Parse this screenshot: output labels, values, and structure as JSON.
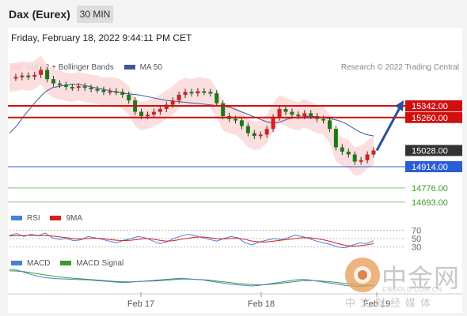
{
  "header": {
    "title": "Dax (Eurex)",
    "timeframe": "30 MIN",
    "datetime": "Friday, February 18, 2022 9:44:11 PM CET"
  },
  "legends": {
    "main": [
      {
        "label": "MA 20 + Bollinger Bands",
        "color": "#f08a8a"
      },
      {
        "label": "MA 50",
        "color": "#3a5a9c"
      }
    ],
    "rsi": [
      {
        "label": "RSI",
        "color": "#4a7fd4"
      },
      {
        "label": "9MA",
        "color": "#d42020"
      }
    ],
    "macd": [
      {
        "label": "MACD",
        "color": "#4a7fd4"
      },
      {
        "label": "MACD Signal",
        "color": "#3a9a2a"
      }
    ]
  },
  "research": "Research © 2022 Trading Central",
  "watermark": {
    "chinese": "中金网",
    "url": "CNGOLD.COM.CN",
    "subtitle": "中文财经媒体"
  },
  "colors": {
    "resistance": "#d01010",
    "support": "#2a5fd4",
    "target": "#3a9a2a",
    "last_price_box": "#333333",
    "arrow": "#2a4f9c"
  },
  "chart_data": {
    "type": "line",
    "x_ticks": [
      "Feb 17",
      "Feb 18",
      "Feb 19"
    ],
    "price_levels": [
      {
        "value": "15342.00",
        "kind": "resistance"
      },
      {
        "value": "15260.00",
        "kind": "resistance"
      },
      {
        "value": "15028.00",
        "kind": "last"
      },
      {
        "value": "14914.00",
        "kind": "support"
      },
      {
        "value": "14776.00",
        "kind": "target"
      },
      {
        "value": "14693.00",
        "kind": "target"
      }
    ],
    "price_series": [
      15540,
      15545,
      15555,
      15548,
      15560,
      15595,
      15530,
      15500,
      15490,
      15475,
      15470,
      15480,
      15470,
      15460,
      15455,
      15440,
      15445,
      15440,
      15420,
      15380,
      15300,
      15270,
      15280,
      15300,
      15320,
      15350,
      15380,
      15420,
      15440,
      15430,
      15445,
      15440,
      15430,
      15360,
      15270,
      15250,
      15240,
      15200,
      15150,
      15130,
      15140,
      15180,
      15260,
      15320,
      15300,
      15280,
      15270,
      15290,
      15270,
      15250,
      15240,
      15180,
      15050,
      15020,
      15000,
      14950,
      14960,
      15000,
      15028
    ],
    "ma50_series": [
      15150,
      15200,
      15270,
      15330,
      15390,
      15440,
      15470,
      15480,
      15490,
      15495,
      15490,
      15480,
      15470,
      15460,
      15450,
      15440,
      15430,
      15425,
      15420,
      15410,
      15400,
      15390,
      15380,
      15375,
      15370,
      15365,
      15360,
      15355,
      15350,
      15345,
      15340,
      15330,
      15310,
      15290,
      15270,
      15250,
      15230,
      15220,
      15230,
      15250,
      15260,
      15265,
      15270,
      15265,
      15260,
      15250,
      15240,
      15220,
      15190,
      15160,
      15140,
      15130
    ],
    "rsi_levels": [
      70,
      50,
      30
    ],
    "rsi_series": [
      58,
      62,
      55,
      60,
      57,
      63,
      52,
      48,
      50,
      45,
      47,
      55,
      52,
      48,
      44,
      40,
      46,
      50,
      55,
      52,
      45,
      38,
      42,
      50,
      56,
      60,
      57,
      52,
      48,
      44,
      50,
      55,
      52,
      40,
      35,
      42,
      46,
      50,
      48,
      52,
      58,
      55,
      50,
      44,
      40,
      36,
      30,
      28,
      34,
      40,
      38,
      45
    ],
    "rsi_ma_series": [
      56,
      57,
      57,
      58,
      57,
      57,
      56,
      54,
      52,
      50,
      49,
      50,
      51,
      50,
      48,
      46,
      45,
      46,
      48,
      50,
      49,
      46,
      44,
      45,
      48,
      51,
      53,
      54,
      52,
      50,
      49,
      50,
      51,
      48,
      44,
      42,
      42,
      44,
      46,
      48,
      50,
      52,
      52,
      50,
      47,
      43,
      38,
      34,
      32,
      33,
      35,
      38
    ],
    "macd_series": [
      40,
      38,
      30,
      22,
      15,
      10,
      8,
      6,
      5,
      4,
      3,
      2,
      0,
      -2,
      -4,
      -6,
      -8,
      -6,
      -4,
      -2,
      0,
      2,
      4,
      6,
      8,
      6,
      4,
      2,
      -2,
      -6,
      -10,
      -14,
      -16,
      -18,
      -20,
      -18,
      -14,
      -10,
      -6,
      -2,
      2,
      4,
      2,
      -2,
      -6,
      -10,
      -14,
      -18,
      -20,
      -22,
      -20,
      -16
    ],
    "macd_signal_series": [
      35,
      34,
      32,
      28,
      24,
      20,
      16,
      13,
      10,
      8,
      6,
      4,
      2,
      0,
      -2,
      -4,
      -5,
      -5,
      -4,
      -3,
      -2,
      -1,
      1,
      3,
      5,
      5,
      4,
      3,
      1,
      -2,
      -5,
      -8,
      -11,
      -13,
      -15,
      -16,
      -15,
      -13,
      -10,
      -7,
      -4,
      -1,
      0,
      -1,
      -3,
      -5,
      -8,
      -11,
      -14,
      -17,
      -18,
      -18
    ]
  }
}
